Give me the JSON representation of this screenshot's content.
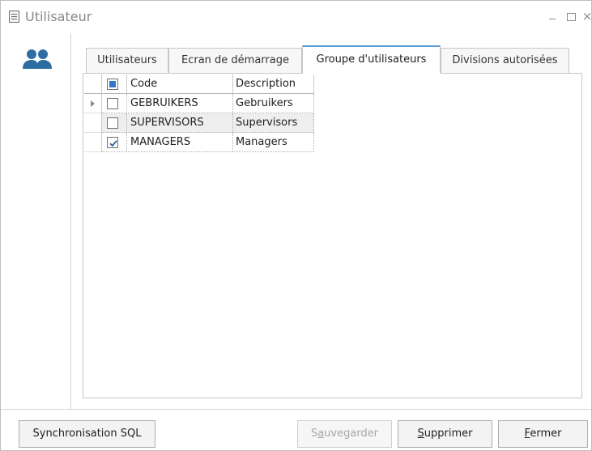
{
  "window": {
    "title": "Utilisateur",
    "icon": "form-icon",
    "controls": {
      "minimize": "minimize-icon",
      "maximize": "maximize-icon",
      "close": "×"
    }
  },
  "sidebar": {
    "icon": "users-group-icon"
  },
  "tabs": [
    {
      "label": "Utilisateurs",
      "active": false
    },
    {
      "label": "Ecran de démarrage",
      "active": false
    },
    {
      "label": "Groupe d'utilisateurs",
      "active": true
    },
    {
      "label": "Divisions autorisées",
      "active": false
    }
  ],
  "grid": {
    "columns": {
      "code": "Code",
      "description": "Description"
    },
    "header_checkbox": "partial",
    "rows": [
      {
        "code": "GEBRUIKERS",
        "description": "Gebruikers",
        "checked": false,
        "current": true
      },
      {
        "code": "SUPERVISORS",
        "description": "Supervisors",
        "checked": false,
        "current": false
      },
      {
        "code": "MANAGERS",
        "description": "Managers",
        "checked": true,
        "current": false
      }
    ]
  },
  "buttons": {
    "sync": "Synchronisation SQL",
    "save": {
      "mnemonic_before": "S",
      "mnemonic": "a",
      "after": "uvegarder",
      "enabled": false
    },
    "delete": {
      "before": "",
      "mnemonic": "S",
      "after": "upprimer"
    },
    "close": {
      "before": "",
      "mnemonic": "F",
      "after": "ermer"
    }
  },
  "colors": {
    "accent": "#5a9bd4",
    "checkbox_fill": "#3277c8",
    "alt_row": "#eeeeee"
  }
}
